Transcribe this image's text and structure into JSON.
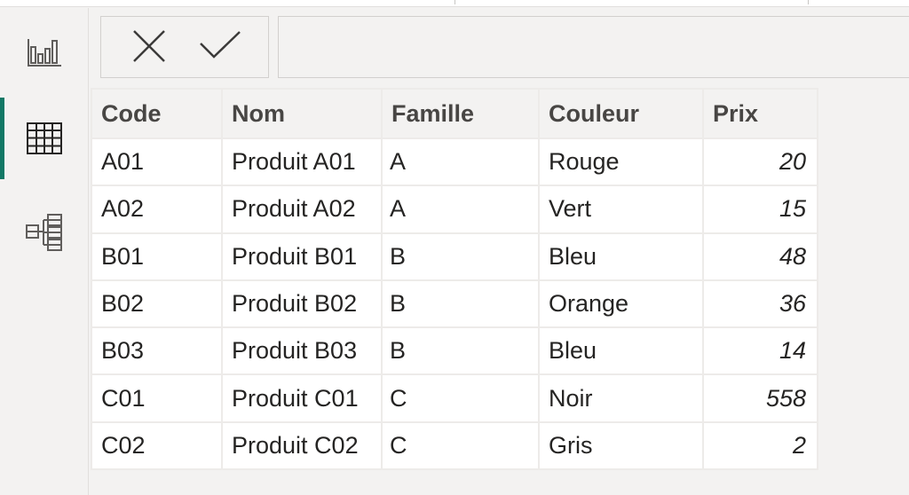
{
  "sidebar": {
    "items": [
      {
        "id": "report",
        "icon": "bar-chart-icon",
        "active": false
      },
      {
        "id": "data",
        "icon": "table-grid-icon",
        "active": true
      },
      {
        "id": "model",
        "icon": "model-icon",
        "active": false
      }
    ],
    "accent": "#117865"
  },
  "formula_bar": {
    "cancel_icon": "close-icon",
    "commit_icon": "checkmark-icon",
    "value": ""
  },
  "table": {
    "columns": [
      "Code",
      "Nom",
      "Famille",
      "Couleur",
      "Prix"
    ],
    "rows": [
      [
        "A01",
        "Produit A01",
        "A",
        "Rouge",
        "20"
      ],
      [
        "A02",
        "Produit A02",
        "A",
        "Vert",
        "15"
      ],
      [
        "B01",
        "Produit B01",
        "B",
        "Bleu",
        "48"
      ],
      [
        "B02",
        "Produit B02",
        "B",
        "Orange",
        "36"
      ],
      [
        "B03",
        "Produit B03",
        "B",
        "Bleu",
        "14"
      ],
      [
        "C01",
        "Produit C01",
        "C",
        "Noir",
        "558"
      ],
      [
        "C02",
        "Produit C02",
        "C",
        "Gris",
        "2"
      ]
    ]
  }
}
